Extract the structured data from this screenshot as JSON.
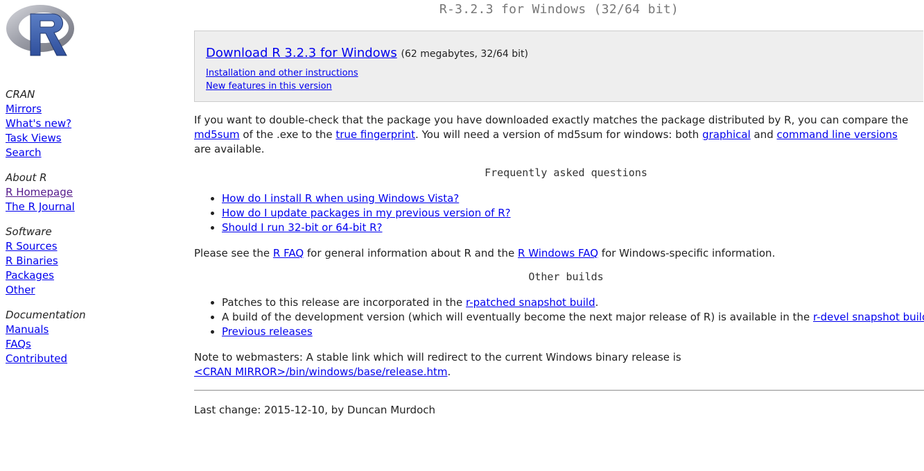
{
  "sidebar": {
    "logo_label": "R",
    "groups": [
      {
        "heading": "CRAN",
        "links": [
          "Mirrors",
          "What's new?",
          "Task Views",
          "Search"
        ]
      },
      {
        "heading": "About R",
        "links": [
          "R Homepage",
          "The R Journal"
        ]
      },
      {
        "heading": "Software",
        "links": [
          "R Sources",
          "R Binaries",
          "Packages",
          "Other"
        ]
      },
      {
        "heading": "Documentation",
        "links": [
          "Manuals",
          "FAQs",
          "Contributed"
        ]
      }
    ]
  },
  "page": {
    "title": "R-3.2.3 for Windows (32/64 bit)",
    "download": {
      "link": "Download R 3.2.3 for Windows",
      "size": "(62 megabytes, 32/64 bit)",
      "install_link": "Installation and other instructions",
      "features_link": "New features in this version"
    },
    "md5_para": {
      "t1": "If you want to double-check that the package you have downloaded exactly matches the package distributed by R, you can compare the ",
      "l1": "md5sum",
      "t2": " of the .exe to the ",
      "l2": "true fingerprint",
      "t3": ". You will need a version of md5sum for windows: both ",
      "l3": "graphical",
      "t4": " and ",
      "l4": "command line versions",
      "t5": " are available."
    },
    "faq_title": "Frequently asked questions",
    "faq_items": [
      "How do I install R when using Windows Vista?",
      "How do I update packages in my previous version of R?",
      "Should I run 32-bit or 64-bit R?"
    ],
    "faq_para": {
      "t1": "Please see the ",
      "l1": "R FAQ",
      "t2": " for general information about R and the ",
      "l2": "R Windows FAQ",
      "t3": " for Windows-specific information."
    },
    "other_title": "Other builds",
    "other_items": {
      "patch_text": "Patches to this release are incorporated in the ",
      "patch_link": "r-patched snapshot build",
      "patch_end": ".",
      "devel_text": "A build of the development version (which will eventually become the next major release of R) is available in the ",
      "devel_link": "r-devel snapshot build",
      "devel_end": ".",
      "previous_link": "Previous releases"
    },
    "webmaster": {
      "text": "Note to webmasters: A stable link which will redirect to the current Windows binary release is",
      "link": "<CRAN MIRROR>/bin/windows/base/release.htm",
      "end": "."
    },
    "last_change": "Last change: 2015-12-10, by Duncan Murdoch"
  }
}
